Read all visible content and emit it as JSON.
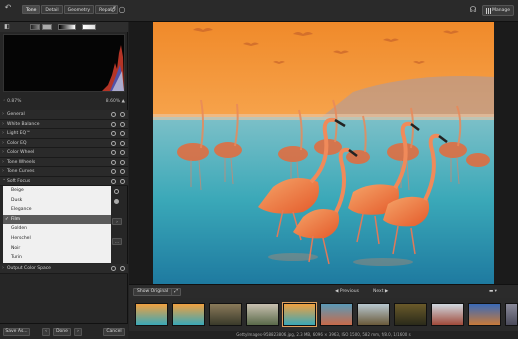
{
  "toolbar": {
    "tabs": [
      "Tone",
      "Detail",
      "Geometry",
      "Repair"
    ],
    "manage_label": "Manage"
  },
  "histogram": {
    "left_value": "0.87%",
    "right_value": "8.60%"
  },
  "tools": [
    {
      "label": "General"
    },
    {
      "label": "White Balance"
    },
    {
      "label": "Light EQ™"
    },
    {
      "label": "Color EQ"
    },
    {
      "label": "Color Wheel"
    },
    {
      "label": "Tone Wheels"
    },
    {
      "label": "Tone Curves"
    },
    {
      "label": "Soft Focus"
    }
  ],
  "presets": {
    "items": [
      "Beige",
      "Dusk",
      "Elegance",
      "Film",
      "Golden",
      "Herschel",
      "Noir",
      "Turin"
    ],
    "selected": "Film"
  },
  "output_tool": {
    "label": "Output Color Space"
  },
  "left_bottom": {
    "save_label": "Save As...",
    "done_label": "Done",
    "cancel_label": "Cancel"
  },
  "viewer": {
    "show_original_label": "Show Original",
    "previous_label": "Previous",
    "next_label": "Next"
  },
  "status": {
    "text": "GettyImages-958823806.jpg, 2.3 MB, 6096 × 3963, ISO 1500, 582 mm, f/8.0, 1/1600 s"
  },
  "colors": {
    "accent": "#e0a060",
    "panel": "#262626",
    "selected_preset": "#5a5a5a"
  }
}
